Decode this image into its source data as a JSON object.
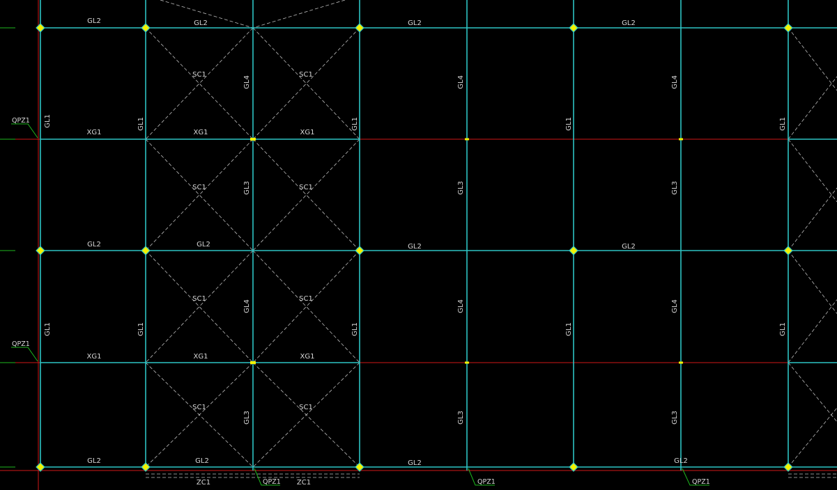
{
  "drawing": {
    "background": "#000000",
    "colors": {
      "grid_line": "#d01818",
      "member": "#2ec4c4",
      "brace": "#bdbdbd",
      "leader": "#1eb81e",
      "node_fill": "#f2f200"
    },
    "labels": {
      "top_beam_gl2": "GL2",
      "column_gl1": "GL1",
      "mid_beam_xg1": "XG1",
      "brace_sc1": "SC1",
      "stud_gl3": "GL3",
      "stud_gl4": "GL4",
      "column_brace_zc1": "ZC1",
      "flange_brace_qpz1": "QPZ1"
    }
  }
}
